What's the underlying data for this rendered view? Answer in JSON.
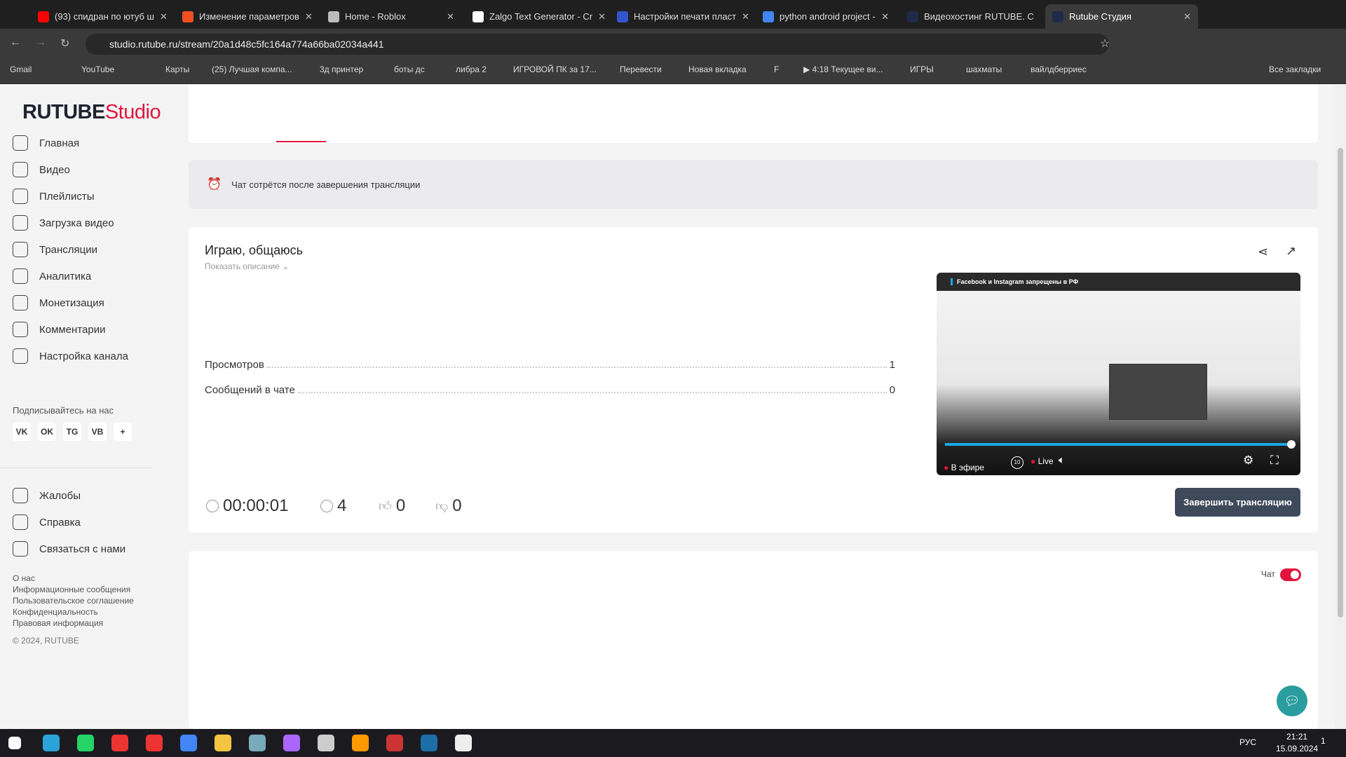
{
  "browser": {
    "tabs": [
      {
        "title": "(93) спидран по ютуб ш",
        "color": "#ff0000"
      },
      {
        "title": "Изменение параметров",
        "color": "#f25022"
      },
      {
        "title": "Home - Roblox",
        "color": "#bbbbbb"
      },
      {
        "title": "Zalgo Text Generator - Cr",
        "color": "#ffffff"
      },
      {
        "title": "Настройки печати пласт",
        "color": "#3355cc"
      },
      {
        "title": "python android project -",
        "color": "#4285f4"
      },
      {
        "title": "Видеохостинг RUTUBE. С",
        "color": "#1f2a4a"
      },
      {
        "title": "Rutube Студия",
        "color": "#1f2a4a"
      }
    ],
    "url": "studio.rutube.ru/stream/20a1d48c5fc164a774a66ba02034a441",
    "bookmarks": [
      "Gmail",
      "",
      "YouTube",
      "",
      "Карты",
      "(25) Лучшая компа...",
      "3д принтер",
      "боты дс",
      "либра 2",
      "ИГРОВОЙ ПК за 17...",
      "Перевести",
      "Новая вкладка",
      "F",
      "▶ 4:18 Текущее ви...",
      "ИГРЫ",
      "шахматы",
      "вайлдберриес"
    ],
    "all_bookmarks": "Все закладки"
  },
  "logo": {
    "brand": "RUTUBE",
    "suffix": "Studio"
  },
  "sidebar": {
    "items": [
      {
        "label": "Главная",
        "icon": "home-icon"
      },
      {
        "label": "Видео",
        "icon": "tv-icon"
      },
      {
        "label": "Плейлисты",
        "icon": "playlist-icon"
      },
      {
        "label": "Загрузка видео",
        "icon": "upload-icon"
      },
      {
        "label": "Трансляции",
        "icon": "broadcast-icon"
      },
      {
        "label": "Аналитика",
        "icon": "chart-icon"
      },
      {
        "label": "Монетизация",
        "icon": "coin-icon"
      },
      {
        "label": "Комментарии",
        "icon": "comments-icon"
      },
      {
        "label": "Настройка канала",
        "icon": "wand-icon"
      }
    ],
    "follow_label": "Подписывайтесь на нас",
    "social": [
      "VK",
      "OK",
      "TG",
      "VB",
      "+"
    ],
    "support": [
      {
        "label": "Жалобы",
        "icon": "flag-icon"
      },
      {
        "label": "Справка",
        "icon": "help-icon"
      },
      {
        "label": "Связаться с нами",
        "icon": "pen-icon"
      }
    ],
    "footer": [
      "О нас",
      "Информационные сообщения",
      "Пользовательское соглашение",
      "Конфиденциальность",
      "Правовая информация"
    ],
    "copyright": "© 2024, RUTUBE"
  },
  "notice": "Чат сотрётся после завершения трансляции",
  "stream": {
    "title": "Играю, общаюсь",
    "show_description": "Показать описание",
    "stats": [
      {
        "label": "Просмотров",
        "value": "1"
      },
      {
        "label": "Сообщений в чате",
        "value": "0"
      }
    ],
    "duration": "00:00:01",
    "viewers": "4",
    "likes": "0",
    "dislikes": "0",
    "end_button": "Завершить трансляцию"
  },
  "player": {
    "banner": "Facebook и Instagram запрещены в РФ",
    "on_air": "В эфире",
    "live": "Live",
    "skip": "10",
    "progress": 1.0
  },
  "chat": {
    "label": "Чат",
    "enabled": true
  },
  "taskbar": {
    "lang": "РУС",
    "time": "21:21",
    "date": "15.09.2024",
    "notifications": "1"
  },
  "colors": {
    "accent": "#e0153e",
    "button": "#3e4a59",
    "progress": "#1aa9e6"
  }
}
